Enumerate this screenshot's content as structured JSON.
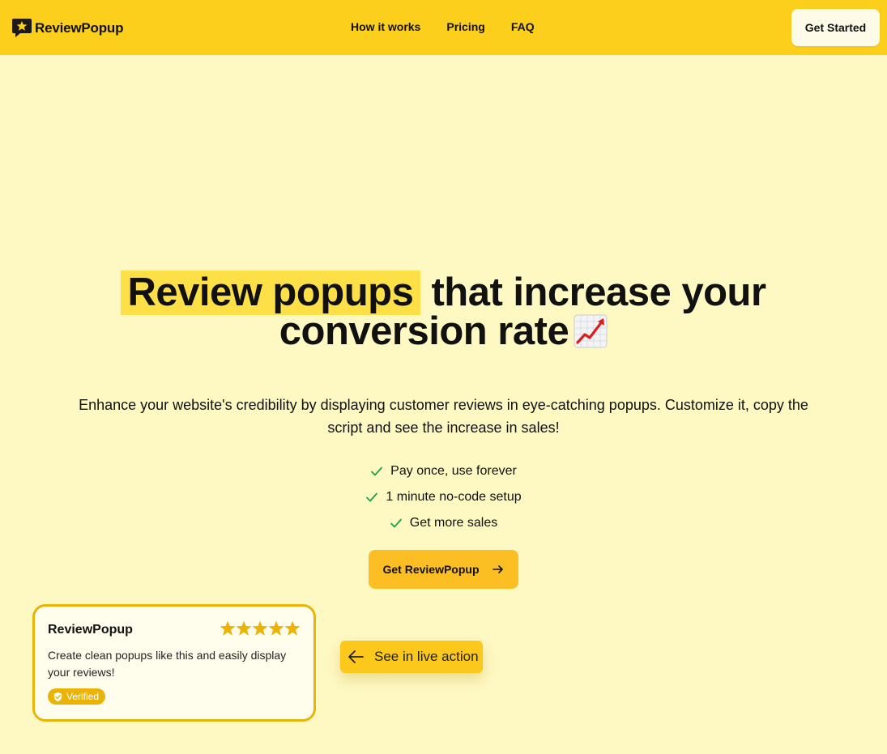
{
  "nav": {
    "brand": "ReviewPopup",
    "links": [
      "How it works",
      "Pricing",
      "FAQ"
    ],
    "cta": "Get Started"
  },
  "hero": {
    "title_highlight": "Review popups",
    "title_rest_line1": "that increase your",
    "title_line2": "conversion rate",
    "title_emoji": "chart-increasing-icon",
    "subtitle": "Enhance your website's credibility by displaying customer reviews in eye-catching popups. Customize it, copy the script and see the increase in sales!",
    "features": [
      "Pay once, use forever",
      "1 minute no-code setup",
      "Get more sales"
    ],
    "cta": "Get ReviewPopup"
  },
  "popup": {
    "name": "ReviewPopup",
    "rating": 5,
    "text": "Create clean popups like this and easily display your reviews!",
    "badge": "Verified"
  },
  "live_button": "See in live action",
  "colors": {
    "nav_bg": "#fccf1c",
    "page_bg": "#fef8c2",
    "highlight": "#fde047",
    "cta": "#fbbf24",
    "popup_border": "#eab308",
    "check": "#16a34a"
  }
}
